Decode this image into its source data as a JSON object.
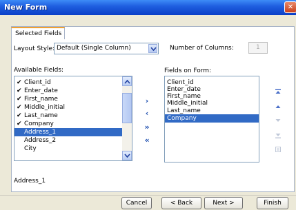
{
  "window": {
    "title": "New Form"
  },
  "tabs": [
    {
      "label": "Selected Fields"
    }
  ],
  "layout_style": {
    "label": "Layout Style:",
    "value": "Default (Single Column)"
  },
  "columns": {
    "label": "Number of Columns:",
    "value": "1"
  },
  "available": {
    "label": "Available Fields:",
    "items": [
      {
        "label": "Client_id",
        "checked": true
      },
      {
        "label": "Enter_date",
        "checked": true
      },
      {
        "label": "First_name",
        "checked": true
      },
      {
        "label": "Middle_initial",
        "checked": true
      },
      {
        "label": "Last_name",
        "checked": true
      },
      {
        "label": "Company",
        "checked": true
      },
      {
        "label": "Address_1",
        "checked": false,
        "selected": true
      },
      {
        "label": "Address_2",
        "checked": false
      },
      {
        "label": "City",
        "checked": false
      }
    ]
  },
  "on_form": {
    "label": "Fields on Form:",
    "items": [
      {
        "label": "Client_id"
      },
      {
        "label": "Enter_date"
      },
      {
        "label": "First_name"
      },
      {
        "label": "Middle_initial"
      },
      {
        "label": "Last_name"
      },
      {
        "label": "Company",
        "selected": true
      }
    ]
  },
  "transfer": {
    "add": "›",
    "remove": "‹",
    "add_all": "»",
    "remove_all": "«"
  },
  "status": {
    "text": "Address_1"
  },
  "buttons": {
    "cancel": "Cancel",
    "back": "< Back",
    "next": "Next >",
    "finish": "Finish"
  },
  "colors": {
    "selection": "#316ac5",
    "titlebar": "#0a3fc7",
    "accent_tab": "#f0a030"
  }
}
